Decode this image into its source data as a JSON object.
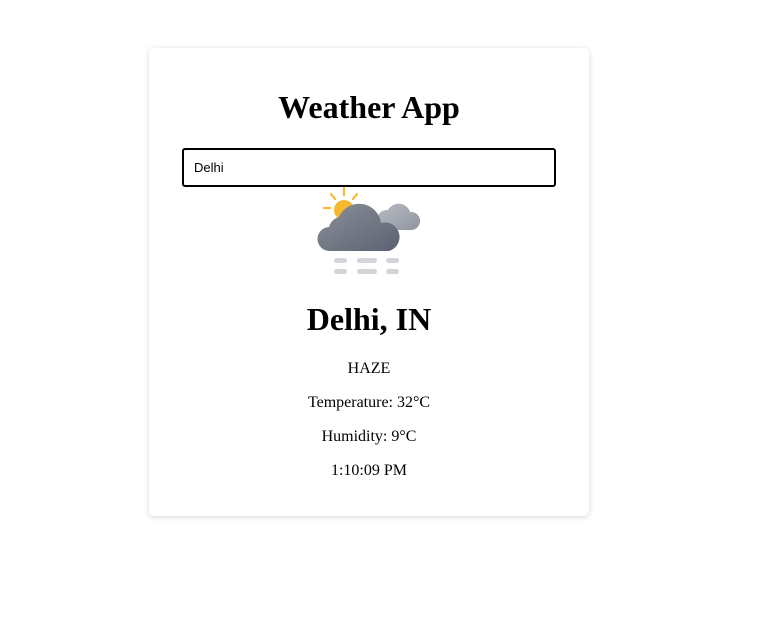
{
  "app": {
    "title": "Weather App"
  },
  "search": {
    "value": "Delhi",
    "placeholder": ""
  },
  "weather": {
    "icon": "haze-cloud-icon",
    "city": "Delhi, IN",
    "description": "HAZE",
    "temperature": "Temperature: 32°C",
    "humidity": "Humidity: 9°C",
    "time": "1:10:09 PM"
  },
  "colors": {
    "sun": "#f5b82e",
    "cloud_dark": "#6b7180",
    "cloud_light": "#a4a8b2",
    "haze_lines": "#d3d5da"
  }
}
